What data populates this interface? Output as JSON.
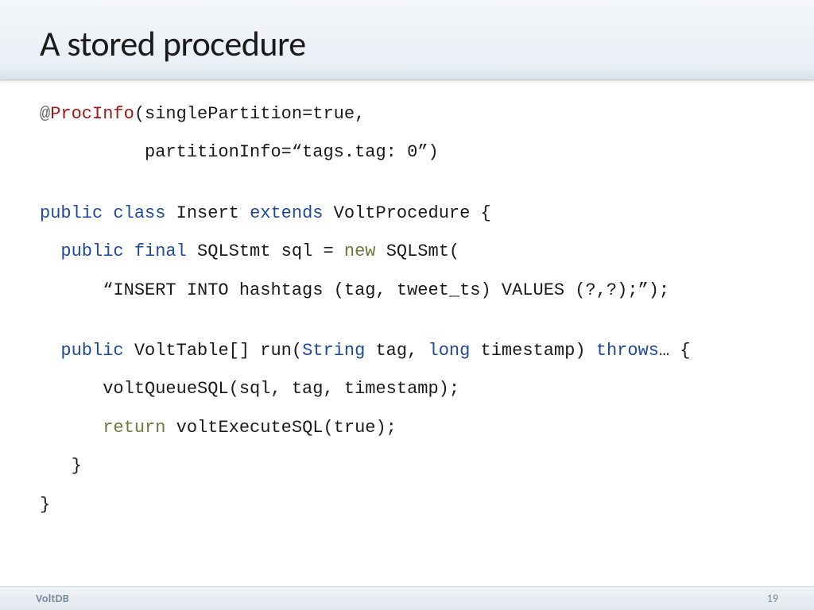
{
  "header": {
    "title": "A stored procedure"
  },
  "code": {
    "l1_at": "@",
    "l1_anno": "ProcInfo",
    "l1_rest": "(singlePartition=true,",
    "l2": "          partitionInfo=“tags.tag: 0”)",
    "l3_public": "public",
    "l3_class": "class",
    "l3_name": " Insert ",
    "l3_extends": "extends",
    "l3_rest": " VoltProcedure {",
    "l4_pad": "  ",
    "l4_public": "public",
    "l4_final": " final",
    "l4_mid": " SQLStmt sql = ",
    "l4_new": "new",
    "l4_rest": " SQLSmt(",
    "l5": "      “INSERT INTO hashtags (tag, tweet_ts) VALUES (?,?);”);",
    "l6_pad": "  ",
    "l6_public": "public",
    "l6_mid1": " VoltTable[] run(",
    "l6_string": "String",
    "l6_mid2": " tag, ",
    "l6_long": "long",
    "l6_mid3": " timestamp) ",
    "l6_throws": "throws",
    "l6_rest": "… {",
    "l7": "      voltQueueSQL(sql, tag, timestamp);",
    "l8_pad": "      ",
    "l8_return": "return",
    "l8_rest": " voltExecuteSQL(true);",
    "l9": "   }",
    "l10": "}"
  },
  "footer": {
    "left": "VoltDB",
    "right": "19"
  }
}
